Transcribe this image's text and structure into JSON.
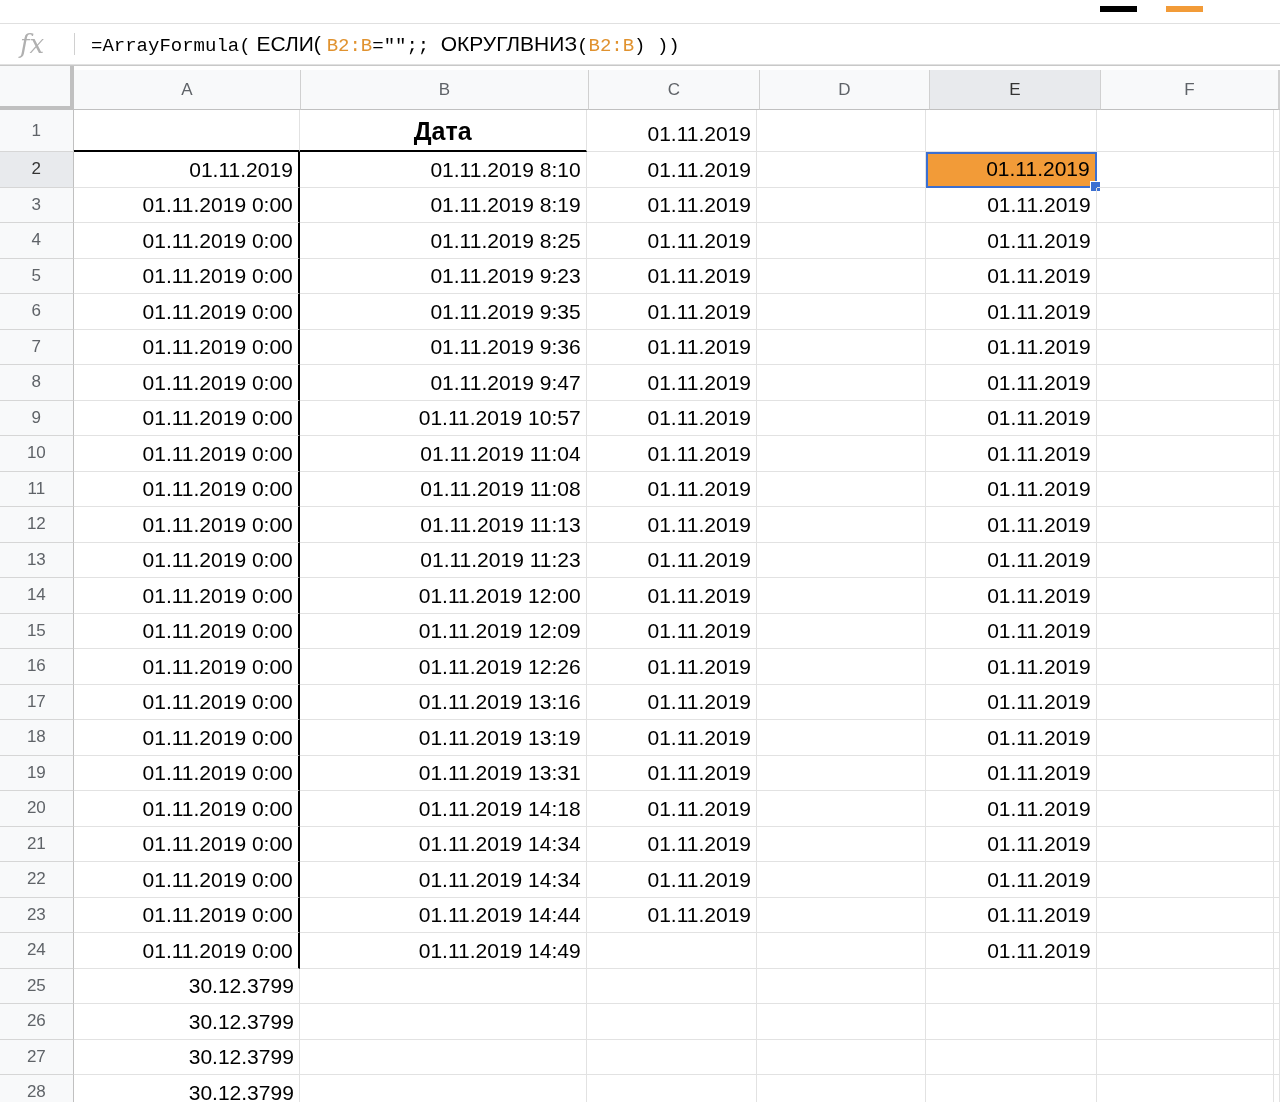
{
  "formula_bar": {
    "icon": "fx",
    "parts": [
      {
        "kind": "code",
        "text": "=ArrayFormula("
      },
      {
        "kind": "text",
        "text": " ЕСЛИ( "
      },
      {
        "kind": "ref",
        "text": "B2:B"
      },
      {
        "kind": "code",
        "text": "=\"\";; "
      },
      {
        "kind": "text",
        "text": "ОКРУГЛВНИЗ"
      },
      {
        "kind": "code",
        "text": "("
      },
      {
        "kind": "ref",
        "text": "B2:B"
      },
      {
        "kind": "code",
        "text": ") ))"
      }
    ]
  },
  "columns": [
    {
      "label": "A",
      "selected": false
    },
    {
      "label": "B",
      "selected": false
    },
    {
      "label": "C",
      "selected": false
    },
    {
      "label": "D",
      "selected": false
    },
    {
      "label": "E",
      "selected": true
    },
    {
      "label": "F",
      "selected": false
    }
  ],
  "rows": [
    {
      "number": "1",
      "kind": "header",
      "selected": false,
      "cells": [
        null,
        "Дата",
        "01.11.2019",
        null,
        null,
        null
      ]
    },
    {
      "number": "2",
      "kind": "data",
      "selected": true,
      "color": "#f29b38",
      "cells": [
        "01.11.2019",
        "01.11.2019 8:10",
        "01.11.2019",
        null,
        "01.11.2019",
        null
      ]
    },
    {
      "number": "3",
      "kind": "data",
      "selected": false,
      "cells": [
        "01.11.2019 0:00",
        "01.11.2019 8:19",
        "01.11.2019",
        null,
        "01.11.2019",
        null
      ]
    },
    {
      "number": "4",
      "kind": "data",
      "selected": false,
      "cells": [
        "01.11.2019 0:00",
        "01.11.2019 8:25",
        "01.11.2019",
        null,
        "01.11.2019",
        null
      ]
    },
    {
      "number": "5",
      "kind": "data",
      "selected": false,
      "cells": [
        "01.11.2019 0:00",
        "01.11.2019 9:23",
        "01.11.2019",
        null,
        "01.11.2019",
        null
      ]
    },
    {
      "number": "6",
      "kind": "data",
      "selected": false,
      "cells": [
        "01.11.2019 0:00",
        "01.11.2019 9:35",
        "01.11.2019",
        null,
        "01.11.2019",
        null
      ]
    },
    {
      "number": "7",
      "kind": "data",
      "selected": false,
      "cells": [
        "01.11.2019 0:00",
        "01.11.2019 9:36",
        "01.11.2019",
        null,
        "01.11.2019",
        null
      ]
    },
    {
      "number": "8",
      "kind": "data",
      "selected": false,
      "cells": [
        "01.11.2019 0:00",
        "01.11.2019 9:47",
        "01.11.2019",
        null,
        "01.11.2019",
        null
      ]
    },
    {
      "number": "9",
      "kind": "data",
      "selected": false,
      "cells": [
        "01.11.2019 0:00",
        "01.11.2019 10:57",
        "01.11.2019",
        null,
        "01.11.2019",
        null
      ]
    },
    {
      "number": "10",
      "kind": "data",
      "selected": false,
      "cells": [
        "01.11.2019 0:00",
        "01.11.2019 11:04",
        "01.11.2019",
        null,
        "01.11.2019",
        null
      ]
    },
    {
      "number": "11",
      "kind": "data",
      "selected": false,
      "cells": [
        "01.11.2019 0:00",
        "01.11.2019 11:08",
        "01.11.2019",
        null,
        "01.11.2019",
        null
      ]
    },
    {
      "number": "12",
      "kind": "data",
      "selected": false,
      "cells": [
        "01.11.2019 0:00",
        "01.11.2019 11:13",
        "01.11.2019",
        null,
        "01.11.2019",
        null
      ]
    },
    {
      "number": "13",
      "kind": "data",
      "selected": false,
      "cells": [
        "01.11.2019 0:00",
        "01.11.2019 11:23",
        "01.11.2019",
        null,
        "01.11.2019",
        null
      ]
    },
    {
      "number": "14",
      "kind": "data",
      "selected": false,
      "cells": [
        "01.11.2019 0:00",
        "01.11.2019 12:00",
        "01.11.2019",
        null,
        "01.11.2019",
        null
      ]
    },
    {
      "number": "15",
      "kind": "data",
      "selected": false,
      "cells": [
        "01.11.2019 0:00",
        "01.11.2019 12:09",
        "01.11.2019",
        null,
        "01.11.2019",
        null
      ]
    },
    {
      "number": "16",
      "kind": "data",
      "selected": false,
      "cells": [
        "01.11.2019 0:00",
        "01.11.2019 12:26",
        "01.11.2019",
        null,
        "01.11.2019",
        null
      ]
    },
    {
      "number": "17",
      "kind": "data",
      "selected": false,
      "cells": [
        "01.11.2019 0:00",
        "01.11.2019 13:16",
        "01.11.2019",
        null,
        "01.11.2019",
        null
      ]
    },
    {
      "number": "18",
      "kind": "data",
      "selected": false,
      "cells": [
        "01.11.2019 0:00",
        "01.11.2019 13:19",
        "01.11.2019",
        null,
        "01.11.2019",
        null
      ]
    },
    {
      "number": "19",
      "kind": "data",
      "selected": false,
      "cells": [
        "01.11.2019 0:00",
        "01.11.2019 13:31",
        "01.11.2019",
        null,
        "01.11.2019",
        null
      ]
    },
    {
      "number": "20",
      "kind": "data",
      "selected": false,
      "cells": [
        "01.11.2019 0:00",
        "01.11.2019 14:18",
        "01.11.2019",
        null,
        "01.11.2019",
        null
      ]
    },
    {
      "number": "21",
      "kind": "data",
      "selected": false,
      "cells": [
        "01.11.2019 0:00",
        "01.11.2019 14:34",
        "01.11.2019",
        null,
        "01.11.2019",
        null
      ]
    },
    {
      "number": "22",
      "kind": "data",
      "selected": false,
      "cells": [
        "01.11.2019 0:00",
        "01.11.2019 14:34",
        "01.11.2019",
        null,
        "01.11.2019",
        null
      ]
    },
    {
      "number": "23",
      "kind": "data",
      "selected": false,
      "cells": [
        "01.11.2019 0:00",
        "01.11.2019 14:44",
        "01.11.2019",
        null,
        "01.11.2019",
        null
      ]
    },
    {
      "number": "24",
      "kind": "data",
      "selected": false,
      "cells": [
        "01.11.2019 0:00",
        "01.11.2019 14:49",
        null,
        null,
        "01.11.2019",
        null
      ]
    },
    {
      "number": "25",
      "kind": "plain",
      "selected": false,
      "cells": [
        "30.12.3799",
        null,
        null,
        null,
        null,
        null
      ]
    },
    {
      "number": "26",
      "kind": "plain",
      "selected": false,
      "cells": [
        "30.12.3799",
        null,
        null,
        null,
        null,
        null
      ]
    },
    {
      "number": "27",
      "kind": "plain",
      "selected": false,
      "cells": [
        "30.12.3799",
        null,
        null,
        null,
        null,
        null
      ]
    },
    {
      "number": "28",
      "kind": "plain",
      "selected": false,
      "cells": [
        "30.12.3799",
        null,
        null,
        null,
        null,
        null
      ]
    }
  ]
}
